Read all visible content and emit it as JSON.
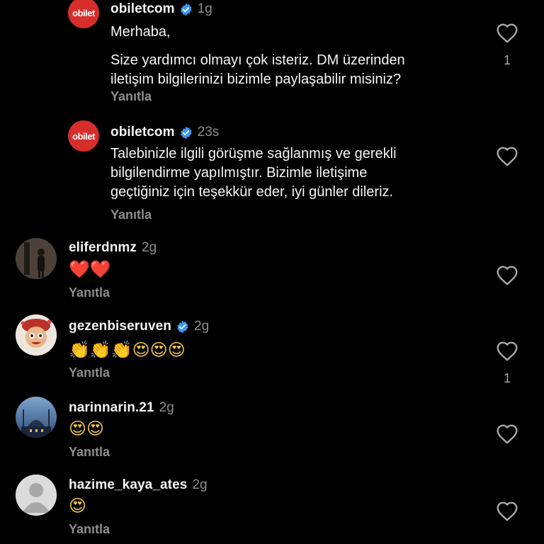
{
  "colors": {
    "background": "#000000",
    "text": "#f5f5f5",
    "secondary": "#8e8e8e",
    "verified": "#3897f0",
    "brand": "#d62e2b"
  },
  "comments": [
    {
      "username": "obiletcom",
      "avatar": "obilet-logo",
      "avatar_text": "obilet",
      "verified": true,
      "time": "1g",
      "lines": [
        "Merhaba,",
        "",
        "Size yardımcı olmayı çok isteriz. DM üzerinden",
        "iletişim bilgilerinizi bizimle paylaşabilir misiniz?"
      ],
      "reply_label": "Yanıtla",
      "likes": "1"
    },
    {
      "username": "obiletcom",
      "avatar": "obilet-logo",
      "avatar_text": "obilet",
      "verified": true,
      "time": "23s",
      "lines": [
        "Talebinizle ilgili görüşme sağlanmış ve gerekli",
        "bilgilendirme yapılmıştır. Bizimle iletişime",
        "geçtiğiniz için teşekkür eder, iyi günler dileriz."
      ],
      "reply_label": "Yanıtla",
      "likes": ""
    },
    {
      "username": "eliferdnmz",
      "avatar": "person-photo",
      "verified": false,
      "time": "2g",
      "emojis": "❤️❤️",
      "reply_label": "Yanıtla",
      "likes": ""
    },
    {
      "username": "gezenbiseruven",
      "avatar": "cartoon-avatar",
      "verified": true,
      "time": "2g",
      "emojis": "👏👏👏😍😍😍",
      "reply_label": "Yanıtla",
      "likes": "1"
    },
    {
      "username": "narinnarin.21",
      "avatar": "mosque-photo",
      "verified": false,
      "time": "2g",
      "emojis": "😍😍",
      "reply_label": "Yanıtla",
      "likes": ""
    },
    {
      "username": "hazime_kaya_ates",
      "avatar": "default-avatar",
      "verified": false,
      "time": "2g",
      "emojis": "😍",
      "reply_label": "Yanıtla",
      "likes": ""
    }
  ],
  "icons": {
    "like": "heart-outline-icon",
    "verified": "verified-badge-icon"
  }
}
